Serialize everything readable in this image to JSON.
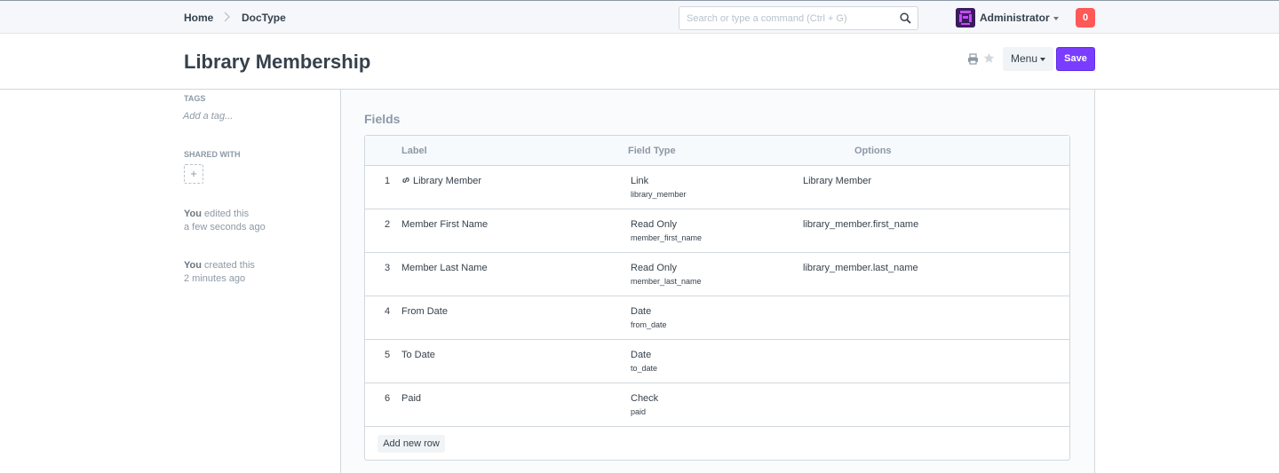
{
  "navbar": {
    "breadcrumbs": [
      "Home",
      "DocType"
    ],
    "search": {
      "placeholder": "Search or type a command (Ctrl + G)",
      "value": ""
    },
    "user": {
      "name": "Administrator"
    },
    "notifications": "0"
  },
  "page": {
    "title": "Library Membership",
    "menu_label": "Menu",
    "save_label": "Save"
  },
  "sidebar": {
    "tags_heading": "TAGS",
    "add_tag": "Add a tag...",
    "shared_heading": "SHARED WITH",
    "share_add": "+",
    "activity": [
      {
        "who": "You",
        "action": " edited this",
        "when": "a few seconds ago"
      },
      {
        "who": "You",
        "action": " created this",
        "when": "2 minutes ago"
      }
    ]
  },
  "fields": {
    "section_title": "Fields",
    "columns": {
      "label": "Label",
      "type": "Field Type",
      "options": "Options"
    },
    "rows": [
      {
        "idx": "1",
        "label": "Library Member",
        "type": "Link",
        "fieldname": "library_member",
        "options": "Library Member"
      },
      {
        "idx": "2",
        "label": "Member First Name",
        "type": "Read Only",
        "fieldname": "member_first_name",
        "options": "library_member.first_name"
      },
      {
        "idx": "3",
        "label": "Member Last Name",
        "type": "Read Only",
        "fieldname": "member_last_name",
        "options": "library_member.last_name"
      },
      {
        "idx": "4",
        "label": "From Date",
        "type": "Date",
        "fieldname": "from_date",
        "options": ""
      },
      {
        "idx": "5",
        "label": "To Date",
        "type": "Date",
        "fieldname": "to_date",
        "options": ""
      },
      {
        "idx": "6",
        "label": "Paid",
        "type": "Check",
        "fieldname": "paid",
        "options": ""
      }
    ],
    "add_row_label": "Add new row"
  },
  "colors": {
    "primary": "#7a3cff",
    "notification": "#ff5858",
    "avatar": "#5e64ff"
  }
}
